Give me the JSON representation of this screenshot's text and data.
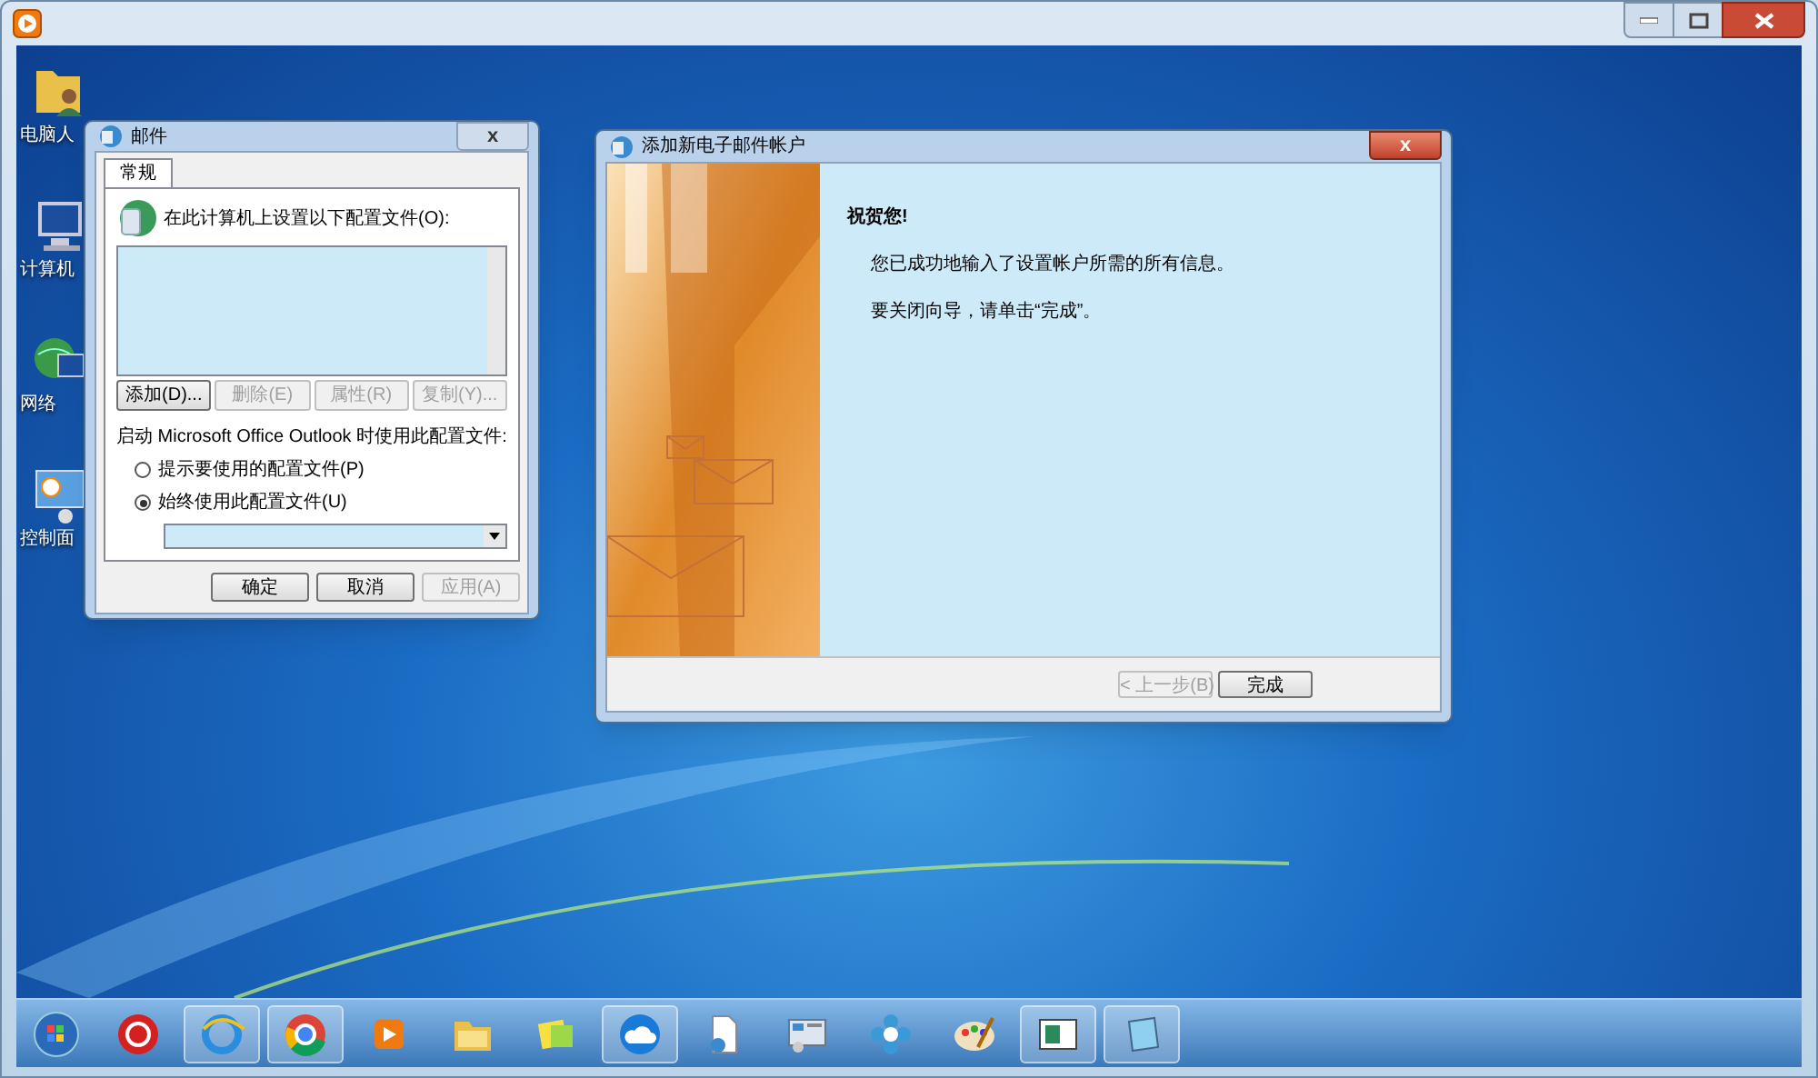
{
  "desktop_icons": [
    {
      "kind": "user-folder",
      "label": "电脑人"
    },
    {
      "kind": "computer",
      "label": "计算机"
    },
    {
      "kind": "network",
      "label": "网络"
    },
    {
      "kind": "control-panel",
      "label": "控制面"
    }
  ],
  "mail_dialog": {
    "title": "邮件",
    "close": "x",
    "tabs": [
      {
        "label": "常规",
        "selected": true
      }
    ],
    "heading": "在此计算机上设置以下配置文件(O):",
    "profile_buttons": [
      {
        "label": "添加(D)...",
        "disabled": false
      },
      {
        "label": "删除(E)",
        "disabled": true
      },
      {
        "label": "属性(R)",
        "disabled": true
      },
      {
        "label": "复制(Y)...",
        "disabled": true
      }
    ],
    "startup_label": "启动 Microsoft Office Outlook 时使用此配置文件:",
    "radios": [
      {
        "label": "提示要使用的配置文件(P)",
        "selected": false
      },
      {
        "label": "始终使用此配置文件(U)",
        "selected": true
      }
    ],
    "footer_buttons": [
      {
        "label": "确定",
        "disabled": false
      },
      {
        "label": "取消",
        "disabled": false
      },
      {
        "label": "应用(A)",
        "disabled": true
      }
    ]
  },
  "wizard": {
    "title": "添加新电子邮件帐户",
    "close": "x",
    "heading": "祝贺您!",
    "lines": [
      "您已成功地输入了设置帐户所需的所有信息。",
      "要关闭向导，请单击“完成”。"
    ],
    "buttons": [
      {
        "label": "< 上一步(B)",
        "disabled": true
      },
      {
        "label": "完成",
        "disabled": false
      }
    ]
  },
  "taskbar": {
    "items": [
      {
        "kind": "start"
      },
      {
        "kind": "red-seal"
      },
      {
        "kind": "ie",
        "selected": true
      },
      {
        "kind": "chrome",
        "selected": true
      },
      {
        "kind": "player"
      },
      {
        "kind": "folder"
      },
      {
        "kind": "notes"
      },
      {
        "kind": "cloud",
        "selected": true
      },
      {
        "kind": "document"
      },
      {
        "kind": "network-panel"
      },
      {
        "kind": "flower"
      },
      {
        "kind": "palette"
      },
      {
        "kind": "panel-window",
        "selected": true
      },
      {
        "kind": "notebook",
        "selected": true
      }
    ]
  }
}
